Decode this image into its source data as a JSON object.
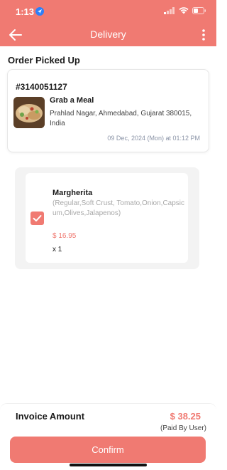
{
  "status_bar": {
    "time": "1:13"
  },
  "app_bar": {
    "title": "Delivery"
  },
  "section": {
    "title": "Order Picked Up"
  },
  "order": {
    "id": "#3140051127",
    "store_name": "Grab a Meal",
    "address": "Prahlad Nagar, Ahmedabad, Gujarat 380015, India",
    "datetime": "09 Dec, 2024 (Mon) at 01:12 PM"
  },
  "items": [
    {
      "name": "Margherita",
      "description": "(Regular,Soft Crust, Tomato,Onion,Capsicum,Olives,Jalapenos)",
      "price": "$ 16.95",
      "quantity": "x 1",
      "checked": true
    }
  ],
  "invoice": {
    "label": "Invoice Amount",
    "amount": "$ 38.25",
    "note": "(Paid By User)"
  },
  "confirm_button": {
    "label": "Confirm"
  },
  "colors": {
    "accent": "#f07a72",
    "muted_text": "#a9a9a9",
    "date_text": "#8a93a6"
  }
}
